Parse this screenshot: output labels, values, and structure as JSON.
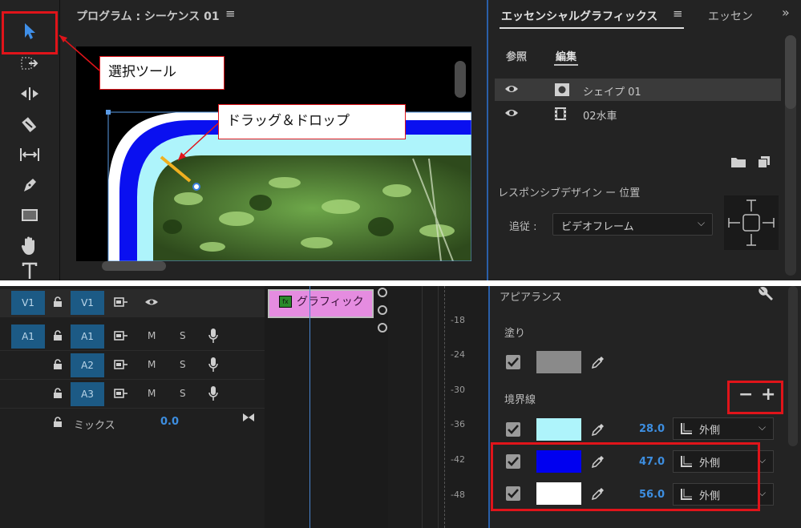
{
  "program_monitor": {
    "title": "プログラム : シーケンス 01",
    "menu_icon": "hamburger-icon"
  },
  "toolbar": {
    "tools": [
      {
        "name": "selection-tool",
        "icon": "arrow-icon",
        "active": true
      },
      {
        "name": "track-select-tool",
        "icon": "track-select-icon"
      },
      {
        "name": "ripple-edit-tool",
        "icon": "ripple-icon"
      },
      {
        "name": "razor-tool",
        "icon": "razor-icon"
      },
      {
        "name": "slip-tool",
        "icon": "slip-icon"
      },
      {
        "name": "pen-tool",
        "icon": "pen-icon"
      },
      {
        "name": "rectangle-tool",
        "icon": "rectangle-icon"
      },
      {
        "name": "hand-tool",
        "icon": "hand-icon"
      },
      {
        "name": "type-tool",
        "icon": "type-icon"
      }
    ]
  },
  "essential_graphics": {
    "tab_title": "エッセンシャルグラフィックス",
    "tab2_title": "エッセン",
    "subtabs": {
      "browse": "参照",
      "edit": "編集"
    },
    "layers": [
      {
        "name": "シェイプ 01",
        "icon": "shape-icon"
      },
      {
        "name": "02水車",
        "icon": "film-icon"
      }
    ],
    "responsive_label": "レスポンシブデザイン ー 位置",
    "follow_label": "追従 :",
    "follow_value": "ビデオフレーム"
  },
  "timeline": {
    "tracks": [
      {
        "src": "V1",
        "target": "V1",
        "type": "video"
      },
      {
        "src": "A1",
        "target": "A1",
        "type": "audio"
      },
      {
        "src": "",
        "target": "A2",
        "type": "audio"
      },
      {
        "src": "",
        "target": "A3",
        "type": "audio"
      }
    ],
    "mute": "M",
    "solo": "S",
    "mix_label": "ミックス",
    "mix_value": "0.0",
    "clip_label": "グラフィック",
    "clip_fx": "fx"
  },
  "audio_meter": {
    "labels": [
      "-18",
      "-24",
      "-30",
      "-36",
      "-42",
      "-48"
    ]
  },
  "appearance": {
    "title": "アピアランス",
    "fill_label": "塗り",
    "fill_color": "#8a8a8a",
    "stroke_label": "境界線",
    "strokes": [
      {
        "color": "#aef4fb",
        "width": "28.0",
        "side": "外側"
      },
      {
        "color": "#0000f0",
        "width": "47.0",
        "side": "外側"
      },
      {
        "color": "#ffffff",
        "width": "56.0",
        "side": "外側"
      }
    ]
  },
  "annotations": {
    "select_tool_callout": "選択ツール",
    "drag_drop_callout": "ドラッグ＆ドロップ"
  },
  "colors": {
    "accent_blue": "#2a5fa8",
    "annotation_red": "#e0141a",
    "clip_pink": "#e58ce0"
  }
}
